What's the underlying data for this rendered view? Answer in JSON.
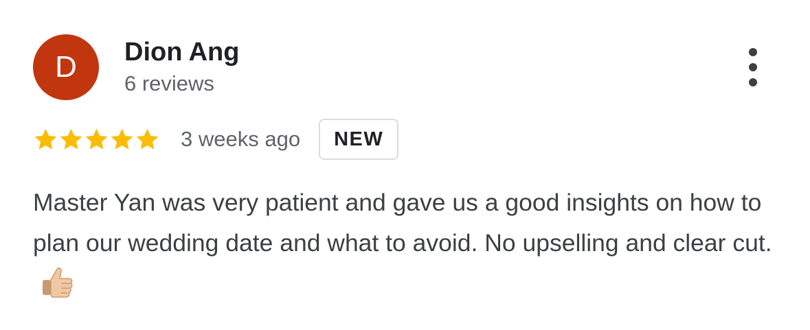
{
  "reviewer": {
    "initial": "D",
    "name": "Dion Ang",
    "reviews": "6 reviews"
  },
  "rating": {
    "stars": 5,
    "max": 5
  },
  "time_ago": "3 weeks ago",
  "badge": "NEW",
  "review_text": "Master Yan was very patient and gave us a good insights on how to plan our wedding date and what to avoid. No upselling and clear cut.",
  "colors": {
    "avatar_bg": "#c2360f",
    "star": "#fbbc04",
    "name": "#202124",
    "secondary": "#5f6368"
  },
  "icons": {
    "more": "more-vert-icon",
    "emoji": "thumbs-up-icon"
  }
}
